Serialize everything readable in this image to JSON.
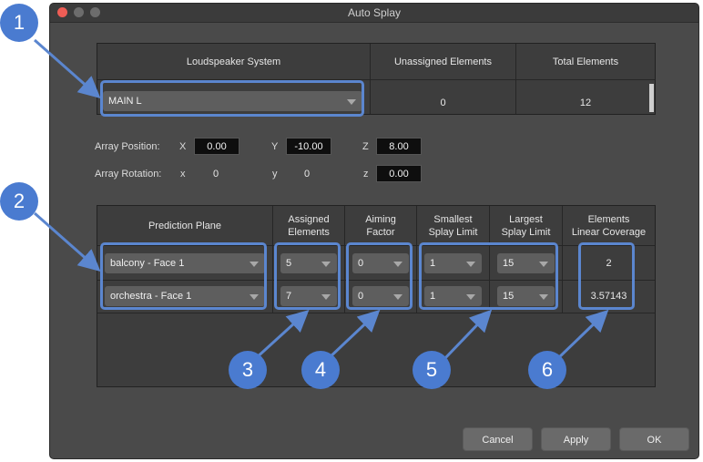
{
  "window": {
    "title": "Auto Splay"
  },
  "loudspeaker_table": {
    "headers": [
      "Loudspeaker System",
      "Unassigned Elements",
      "Total Elements"
    ],
    "system": "MAIN L",
    "unassigned": "0",
    "total": "12"
  },
  "array": {
    "position_label": "Array Position:",
    "rotation_label": "Array Rotation:",
    "X": {
      "label": "X",
      "value": "0.00"
    },
    "Y": {
      "label": "Y",
      "value": "-10.00"
    },
    "Z": {
      "label": "Z",
      "value": "8.00"
    },
    "x": {
      "label": "x",
      "value": "0"
    },
    "y": {
      "label": "y",
      "value": "0"
    },
    "z": {
      "label": "z",
      "value": "0.00"
    }
  },
  "prediction_table": {
    "headers": {
      "plane": "Prediction Plane",
      "assigned": "Assigned\nElements",
      "aiming": "Aiming\nFactor",
      "smallest": "Smallest\nSplay Limit",
      "largest": "Largest\nSplay Limit",
      "coverage": "Elements\nLinear Coverage"
    },
    "rows": [
      {
        "plane": "balcony - Face 1",
        "assigned": "5",
        "aiming": "0",
        "smallest": "1",
        "largest": "15",
        "coverage": "2"
      },
      {
        "plane": "orchestra - Face 1",
        "assigned": "7",
        "aiming": "0",
        "smallest": "1",
        "largest": "15",
        "coverage": "3.57143"
      }
    ]
  },
  "buttons": {
    "cancel": "Cancel",
    "apply": "Apply",
    "ok": "OK"
  },
  "callouts": [
    "1",
    "2",
    "3",
    "4",
    "5",
    "6"
  ],
  "colors": {
    "highlight": "#5b86cf",
    "badge": "#4a7bd0",
    "window_bg": "#4a4a4a"
  }
}
